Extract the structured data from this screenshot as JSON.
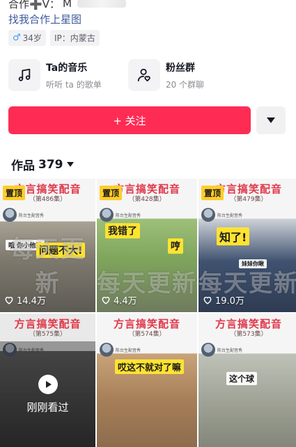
{
  "profile": {
    "contact_prefix": "合作➕V：",
    "contact_value": "M",
    "star_link": "找我合作上星图",
    "tags": [
      {
        "icon": "male-icon",
        "text": "34岁"
      },
      {
        "icon": "",
        "text": "IP：内蒙古"
      }
    ]
  },
  "features": [
    {
      "icon": "music-note-icon",
      "title": "Ta的音乐",
      "subtitle": "听听 ta 的歌单"
    },
    {
      "icon": "fan-group-icon",
      "title": "粉丝群",
      "subtitle": "20 个群聊"
    }
  ],
  "actions": {
    "follow_label": "+ 关注",
    "more_icon": "triangle-down-icon"
  },
  "works": {
    "label": "作品",
    "count": "379"
  },
  "tiles": [
    {
      "series": "方言搞笑配音",
      "episode": "（第486集）",
      "pinned": "置顶",
      "caption": "问题不大!",
      "small_caption": "哦 你小他妈",
      "watermark": "每天更新",
      "likes": "14.4万",
      "channel": "陈台生配音秀"
    },
    {
      "series": "方言搞笑配音",
      "episode": "（第428集）",
      "pinned": "置顶",
      "caption": "我错了",
      "caption2": "哼",
      "watermark": "每天更新",
      "likes": "4.4万",
      "channel": "陈台生配音秀"
    },
    {
      "series": "方言搞笑配音",
      "episode": "（第479集）",
      "pinned": "置顶",
      "caption": "知了!",
      "small_caption": "妹妹你瞅",
      "watermark": "每天更新",
      "likes": "19.0万",
      "channel": "陈台生配音秀"
    },
    {
      "series": "方言搞笑配音",
      "episode": "（第575集）",
      "recent": "刚刚看过",
      "channel": "陈台生配音秀"
    },
    {
      "series": "方言搞笑配音",
      "episode": "（第574集）",
      "caption": "哎这不就对了嘛",
      "channel": "陈台生配音秀"
    },
    {
      "series": "方言搞笑配音",
      "episode": "（第573集）",
      "caption": "这个球",
      "channel": "陈台生配音秀"
    }
  ],
  "colors": {
    "accent": "#fe2c55",
    "link": "#3e5a9c",
    "pin": "#ffcd2a",
    "series_title": "#e0384a"
  }
}
